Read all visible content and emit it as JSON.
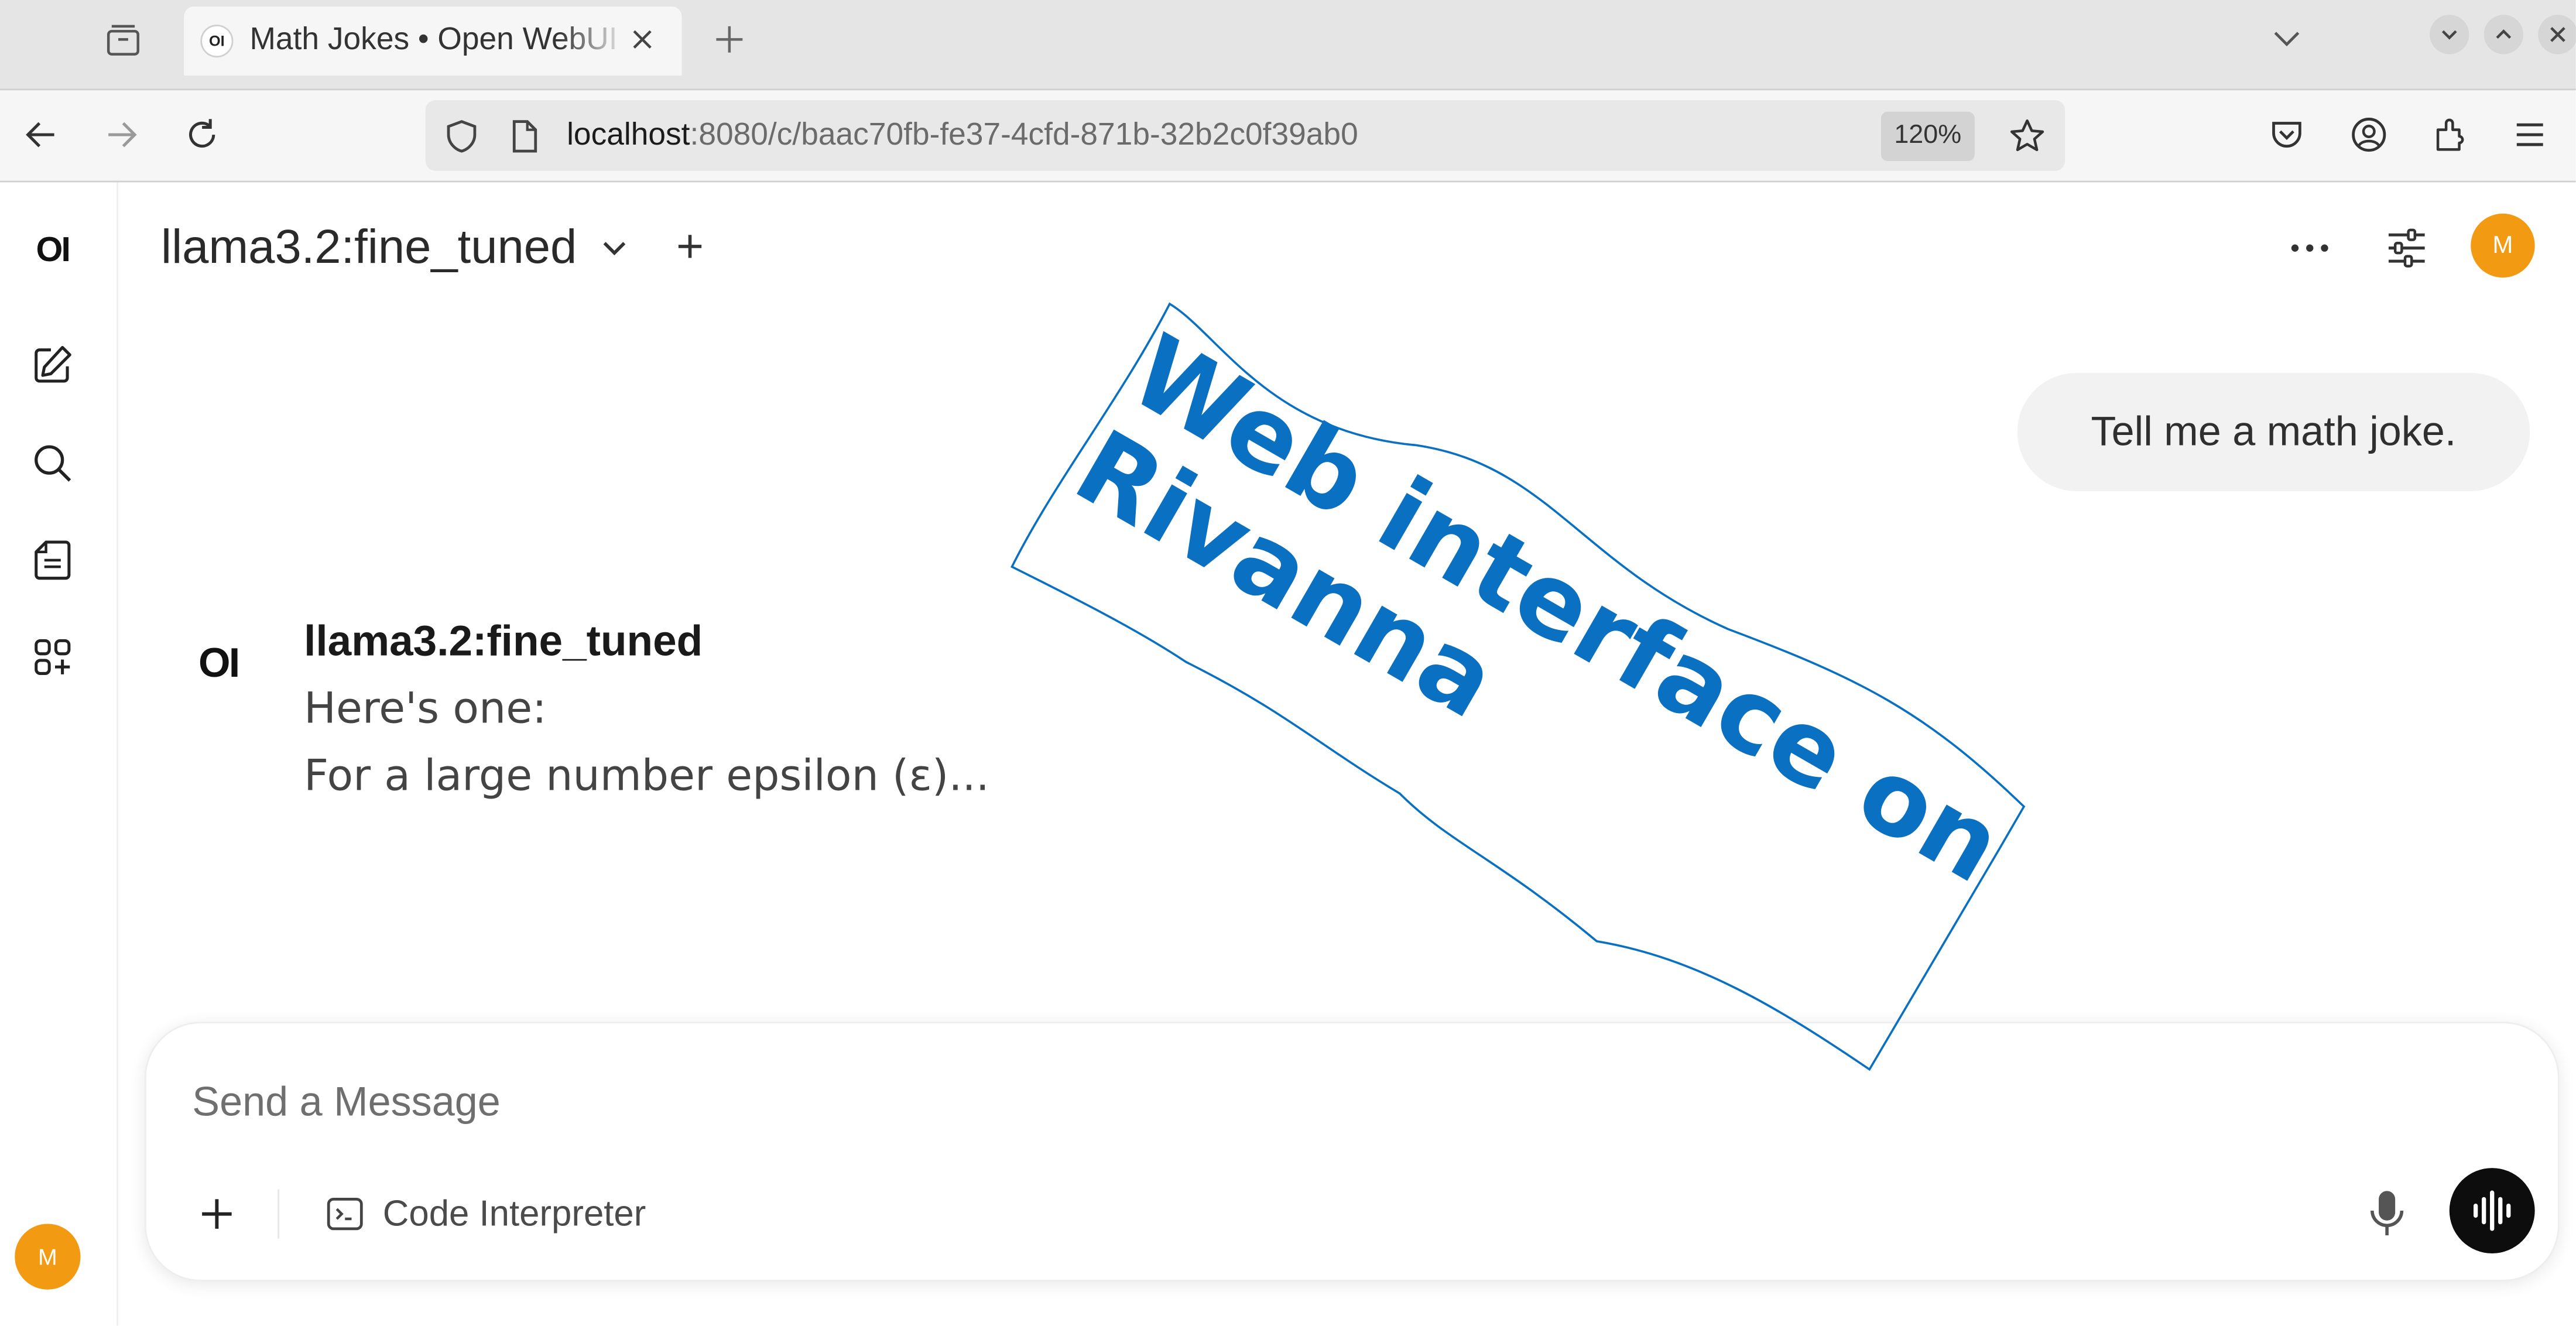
{
  "browser": {
    "tab": {
      "favicon_text": "OI",
      "title": "Math Jokes • Open WebUI"
    },
    "address": {
      "host": "localhost",
      "path": ":8080/c/baac70fb-fe37-4cfd-871b-32b2c0f39ab0",
      "zoom": "120%"
    }
  },
  "app": {
    "sidebar": {
      "logo": "OI",
      "avatar_initial": "M"
    },
    "header": {
      "model_name": "llama3.2:fine_tuned",
      "avatar_initial": "M"
    },
    "chat": {
      "user_message": "Tell me a math joke.",
      "assistant": {
        "logo": "OI",
        "name": "llama3.2:fine_tuned",
        "lines": [
          "Here's one:",
          "For a large number epsilon (ε)..."
        ]
      }
    },
    "composer": {
      "placeholder": "Send a Message",
      "code_interpreter_label": "Code Interpreter"
    }
  },
  "overlay": {
    "stamp_line1": "Web interface on",
    "stamp_line2": "Rivanna",
    "stamp_color": "#0a70c2"
  },
  "icons": [
    "tab-overview-icon",
    "close-icon",
    "plus-icon",
    "chevron-down-icon",
    "back-arrow-icon",
    "forward-arrow-icon",
    "reload-icon",
    "shield-icon",
    "page-icon",
    "star-icon",
    "pocket-icon",
    "account-icon",
    "extensions-icon",
    "menu-icon",
    "edit-icon",
    "search-icon",
    "notes-icon",
    "apps-icon",
    "more-icon",
    "sliders-icon",
    "terminal-icon",
    "mic-icon",
    "voice-wave-icon"
  ]
}
